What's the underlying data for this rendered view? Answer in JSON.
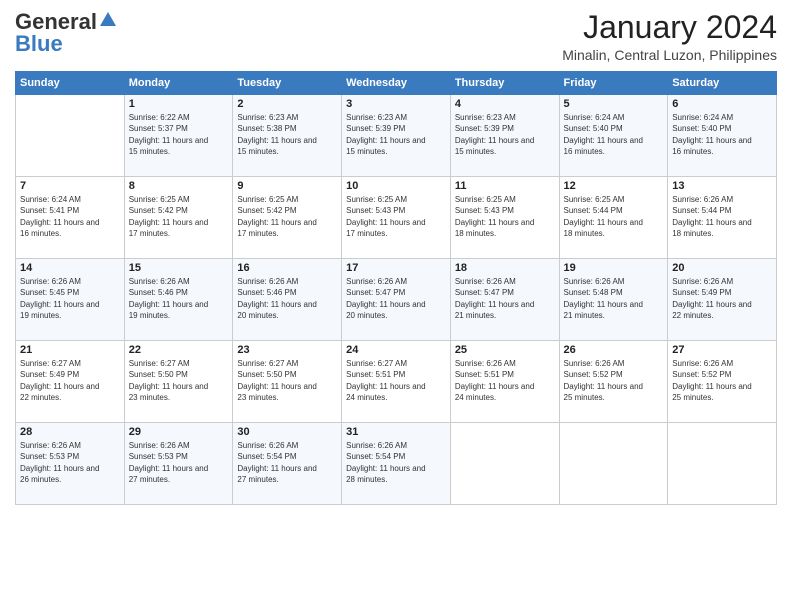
{
  "logo": {
    "general": "General",
    "blue": "Blue"
  },
  "header": {
    "month": "January 2024",
    "location": "Minalin, Central Luzon, Philippines"
  },
  "days_of_week": [
    "Sunday",
    "Monday",
    "Tuesday",
    "Wednesday",
    "Thursday",
    "Friday",
    "Saturday"
  ],
  "weeks": [
    [
      {
        "day": "",
        "sunrise": "",
        "sunset": "",
        "daylight": ""
      },
      {
        "day": "1",
        "sunrise": "Sunrise: 6:22 AM",
        "sunset": "Sunset: 5:37 PM",
        "daylight": "Daylight: 11 hours and 15 minutes."
      },
      {
        "day": "2",
        "sunrise": "Sunrise: 6:23 AM",
        "sunset": "Sunset: 5:38 PM",
        "daylight": "Daylight: 11 hours and 15 minutes."
      },
      {
        "day": "3",
        "sunrise": "Sunrise: 6:23 AM",
        "sunset": "Sunset: 5:39 PM",
        "daylight": "Daylight: 11 hours and 15 minutes."
      },
      {
        "day": "4",
        "sunrise": "Sunrise: 6:23 AM",
        "sunset": "Sunset: 5:39 PM",
        "daylight": "Daylight: 11 hours and 15 minutes."
      },
      {
        "day": "5",
        "sunrise": "Sunrise: 6:24 AM",
        "sunset": "Sunset: 5:40 PM",
        "daylight": "Daylight: 11 hours and 16 minutes."
      },
      {
        "day": "6",
        "sunrise": "Sunrise: 6:24 AM",
        "sunset": "Sunset: 5:40 PM",
        "daylight": "Daylight: 11 hours and 16 minutes."
      }
    ],
    [
      {
        "day": "7",
        "sunrise": "Sunrise: 6:24 AM",
        "sunset": "Sunset: 5:41 PM",
        "daylight": "Daylight: 11 hours and 16 minutes."
      },
      {
        "day": "8",
        "sunrise": "Sunrise: 6:25 AM",
        "sunset": "Sunset: 5:42 PM",
        "daylight": "Daylight: 11 hours and 17 minutes."
      },
      {
        "day": "9",
        "sunrise": "Sunrise: 6:25 AM",
        "sunset": "Sunset: 5:42 PM",
        "daylight": "Daylight: 11 hours and 17 minutes."
      },
      {
        "day": "10",
        "sunrise": "Sunrise: 6:25 AM",
        "sunset": "Sunset: 5:43 PM",
        "daylight": "Daylight: 11 hours and 17 minutes."
      },
      {
        "day": "11",
        "sunrise": "Sunrise: 6:25 AM",
        "sunset": "Sunset: 5:43 PM",
        "daylight": "Daylight: 11 hours and 18 minutes."
      },
      {
        "day": "12",
        "sunrise": "Sunrise: 6:25 AM",
        "sunset": "Sunset: 5:44 PM",
        "daylight": "Daylight: 11 hours and 18 minutes."
      },
      {
        "day": "13",
        "sunrise": "Sunrise: 6:26 AM",
        "sunset": "Sunset: 5:44 PM",
        "daylight": "Daylight: 11 hours and 18 minutes."
      }
    ],
    [
      {
        "day": "14",
        "sunrise": "Sunrise: 6:26 AM",
        "sunset": "Sunset: 5:45 PM",
        "daylight": "Daylight: 11 hours and 19 minutes."
      },
      {
        "day": "15",
        "sunrise": "Sunrise: 6:26 AM",
        "sunset": "Sunset: 5:46 PM",
        "daylight": "Daylight: 11 hours and 19 minutes."
      },
      {
        "day": "16",
        "sunrise": "Sunrise: 6:26 AM",
        "sunset": "Sunset: 5:46 PM",
        "daylight": "Daylight: 11 hours and 20 minutes."
      },
      {
        "day": "17",
        "sunrise": "Sunrise: 6:26 AM",
        "sunset": "Sunset: 5:47 PM",
        "daylight": "Daylight: 11 hours and 20 minutes."
      },
      {
        "day": "18",
        "sunrise": "Sunrise: 6:26 AM",
        "sunset": "Sunset: 5:47 PM",
        "daylight": "Daylight: 11 hours and 21 minutes."
      },
      {
        "day": "19",
        "sunrise": "Sunrise: 6:26 AM",
        "sunset": "Sunset: 5:48 PM",
        "daylight": "Daylight: 11 hours and 21 minutes."
      },
      {
        "day": "20",
        "sunrise": "Sunrise: 6:26 AM",
        "sunset": "Sunset: 5:49 PM",
        "daylight": "Daylight: 11 hours and 22 minutes."
      }
    ],
    [
      {
        "day": "21",
        "sunrise": "Sunrise: 6:27 AM",
        "sunset": "Sunset: 5:49 PM",
        "daylight": "Daylight: 11 hours and 22 minutes."
      },
      {
        "day": "22",
        "sunrise": "Sunrise: 6:27 AM",
        "sunset": "Sunset: 5:50 PM",
        "daylight": "Daylight: 11 hours and 23 minutes."
      },
      {
        "day": "23",
        "sunrise": "Sunrise: 6:27 AM",
        "sunset": "Sunset: 5:50 PM",
        "daylight": "Daylight: 11 hours and 23 minutes."
      },
      {
        "day": "24",
        "sunrise": "Sunrise: 6:27 AM",
        "sunset": "Sunset: 5:51 PM",
        "daylight": "Daylight: 11 hours and 24 minutes."
      },
      {
        "day": "25",
        "sunrise": "Sunrise: 6:26 AM",
        "sunset": "Sunset: 5:51 PM",
        "daylight": "Daylight: 11 hours and 24 minutes."
      },
      {
        "day": "26",
        "sunrise": "Sunrise: 6:26 AM",
        "sunset": "Sunset: 5:52 PM",
        "daylight": "Daylight: 11 hours and 25 minutes."
      },
      {
        "day": "27",
        "sunrise": "Sunrise: 6:26 AM",
        "sunset": "Sunset: 5:52 PM",
        "daylight": "Daylight: 11 hours and 25 minutes."
      }
    ],
    [
      {
        "day": "28",
        "sunrise": "Sunrise: 6:26 AM",
        "sunset": "Sunset: 5:53 PM",
        "daylight": "Daylight: 11 hours and 26 minutes."
      },
      {
        "day": "29",
        "sunrise": "Sunrise: 6:26 AM",
        "sunset": "Sunset: 5:53 PM",
        "daylight": "Daylight: 11 hours and 27 minutes."
      },
      {
        "day": "30",
        "sunrise": "Sunrise: 6:26 AM",
        "sunset": "Sunset: 5:54 PM",
        "daylight": "Daylight: 11 hours and 27 minutes."
      },
      {
        "day": "31",
        "sunrise": "Sunrise: 6:26 AM",
        "sunset": "Sunset: 5:54 PM",
        "daylight": "Daylight: 11 hours and 28 minutes."
      },
      {
        "day": "",
        "sunrise": "",
        "sunset": "",
        "daylight": ""
      },
      {
        "day": "",
        "sunrise": "",
        "sunset": "",
        "daylight": ""
      },
      {
        "day": "",
        "sunrise": "",
        "sunset": "",
        "daylight": ""
      }
    ]
  ]
}
